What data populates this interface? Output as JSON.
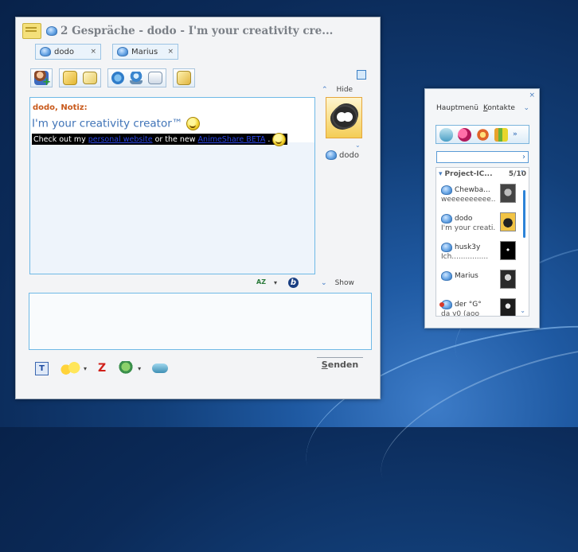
{
  "chat_window": {
    "title": "2 Gespräche - dodo - I'm your creativity cre...",
    "tabs": [
      {
        "label": "dodo",
        "close": "×"
      },
      {
        "label": "Marius",
        "close": "×"
      }
    ],
    "hide_label": "Hide",
    "show_label": "Show",
    "history": {
      "note_header": "dodo, Notiz:",
      "note_text": "I'm your creativity creator™",
      "message_prefix": "Check out my",
      "link1": "personal website",
      "message_mid": "or the new",
      "link2": "AnimeShare BETA",
      "message_end": "."
    },
    "avatar_name": "dodo",
    "spell_label": "AZ",
    "send_button": {
      "underlined": "S",
      "rest": "enden"
    }
  },
  "main_window": {
    "close": "×",
    "menu": {
      "main": "Hauptmenü",
      "contacts_k": "K",
      "contacts_rest": "ontakte"
    },
    "group": {
      "name": "Project-IC...",
      "count": "5/10"
    },
    "contacts": [
      {
        "name": "Chewba...",
        "status": "weeeeeeeeee..."
      },
      {
        "name": "dodo",
        "status": "I'm your creati..."
      },
      {
        "name": "husk3y",
        "status": "Ich................"
      },
      {
        "name": "Marius",
        "status": ""
      },
      {
        "name": "der °G°",
        "status": "da y0 (aoo"
      }
    ]
  },
  "colors": {
    "accent_blue": "#6fb9e6",
    "note_orange": "#c8591b",
    "note_text_blue": "#3f73b7",
    "link_blue": "#2b46e6"
  }
}
